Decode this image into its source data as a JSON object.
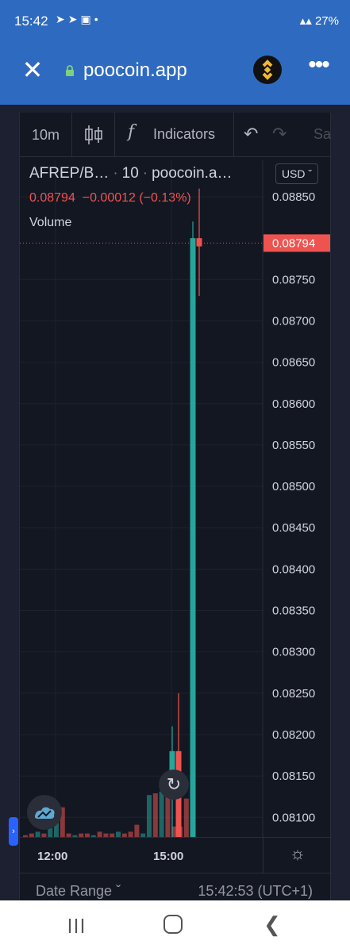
{
  "status_bar": {
    "time": "15:42",
    "battery": "27%"
  },
  "browser": {
    "host": "poocoin.app"
  },
  "toolbar": {
    "interval": "10m",
    "indicators_label": "Indicators",
    "save_label": "Sa"
  },
  "legend": {
    "symbol": "AFREP/B…",
    "interval": "10",
    "source": "poocoin.a…",
    "last": "0.08794",
    "change": "−0.00012",
    "change_pct": "(−0.13%)",
    "volume_label": "Volume",
    "currency": "USD"
  },
  "bottom": {
    "date_range": "Date Range",
    "clock": "15:42:53 (UTC+1)"
  },
  "colors": {
    "up": "#26a69a",
    "down": "#ef5350",
    "background": "#131722",
    "browser_bar": "#2e6bc0"
  },
  "chart_data": {
    "type": "candlestick",
    "price_axis": {
      "ticks": [
        0.0885,
        0.0875,
        0.087,
        0.0865,
        0.086,
        0.0855,
        0.085,
        0.0845,
        0.084,
        0.0835,
        0.083,
        0.0825,
        0.082,
        0.0815,
        0.081
      ],
      "tick_labels": [
        "0.08850",
        "0.08750",
        "0.08700",
        "0.08650",
        "0.08600",
        "0.08550",
        "0.08500",
        "0.08450",
        "0.08400",
        "0.08350",
        "0.08300",
        "0.08250",
        "0.08200",
        "0.08150",
        "0.08100"
      ],
      "last_price": 0.08794,
      "last_price_label": "0.08794",
      "range": [
        0.0807,
        0.0887
      ]
    },
    "time_axis": {
      "tick_labels": [
        "12:00",
        "15:00"
      ]
    },
    "candles": [
      {
        "open": 0.0815,
        "high": 0.0821,
        "low": 0.0807,
        "close": 0.0818,
        "dir": "up"
      },
      {
        "open": 0.0818,
        "high": 0.0825,
        "low": 0.0807,
        "close": 0.0807,
        "dir": "down"
      },
      {
        "open": 0.0807,
        "high": 0.0882,
        "low": 0.0807,
        "close": 0.088,
        "dir": "up"
      },
      {
        "open": 0.088,
        "high": 0.0886,
        "low": 0.0873,
        "close": 0.0879,
        "dir": "down"
      }
    ],
    "volume": [
      {
        "v": 1,
        "dir": "down"
      },
      {
        "v": 2,
        "dir": "down"
      },
      {
        "v": 3,
        "dir": "up"
      },
      {
        "v": 2,
        "dir": "down"
      },
      {
        "v": 14,
        "dir": "up"
      },
      {
        "v": 16,
        "dir": "up"
      },
      {
        "v": 17,
        "dir": "down"
      },
      {
        "v": 2,
        "dir": "down"
      },
      {
        "v": 1,
        "dir": "up"
      },
      {
        "v": 2,
        "dir": "down"
      },
      {
        "v": 2,
        "dir": "down"
      },
      {
        "v": 1,
        "dir": "up"
      },
      {
        "v": 3,
        "dir": "down"
      },
      {
        "v": 2,
        "dir": "down"
      },
      {
        "v": 2,
        "dir": "down"
      },
      {
        "v": 3,
        "dir": "up"
      },
      {
        "v": 2,
        "dir": "down"
      },
      {
        "v": 3,
        "dir": "down"
      },
      {
        "v": 7,
        "dir": "down"
      },
      {
        "v": 2,
        "dir": "up"
      },
      {
        "v": 24,
        "dir": "up"
      },
      {
        "v": 25,
        "dir": "down"
      },
      {
        "v": 26,
        "dir": "up"
      },
      {
        "v": 28,
        "dir": "down"
      },
      {
        "v": 6,
        "dir": "down"
      },
      {
        "v": 6,
        "dir": "down"
      },
      {
        "v": 22,
        "dir": "down"
      }
    ]
  }
}
